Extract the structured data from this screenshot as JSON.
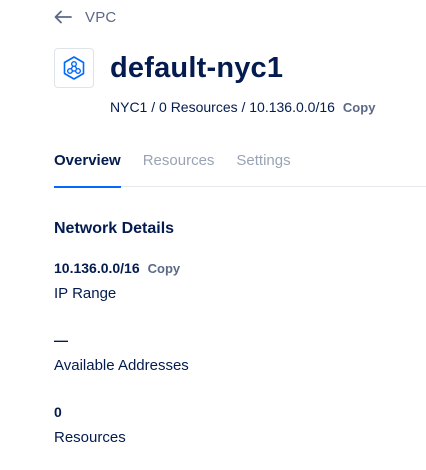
{
  "nav": {
    "back_label": "VPC"
  },
  "header": {
    "title": "default-nyc1",
    "meta": "NYC1 / 0 Resources / 10.136.0.0/16",
    "copy_label": "Copy",
    "icon": "vpc-network-icon"
  },
  "tabs": [
    {
      "label": "Overview",
      "active": true
    },
    {
      "label": "Resources",
      "active": false
    },
    {
      "label": "Settings",
      "active": false
    }
  ],
  "network_details": {
    "title": "Network Details",
    "items": [
      {
        "value": "10.136.0.0/16",
        "label": "IP Range",
        "copy_label": "Copy"
      },
      {
        "value": "—",
        "label": "Available Addresses"
      },
      {
        "value": "0",
        "label": "Resources"
      }
    ]
  },
  "colors": {
    "primary_text": "#031b4e",
    "muted_text": "#5b6987",
    "inactive_tab": "#9aa3b4",
    "accent": "#0069ff"
  }
}
